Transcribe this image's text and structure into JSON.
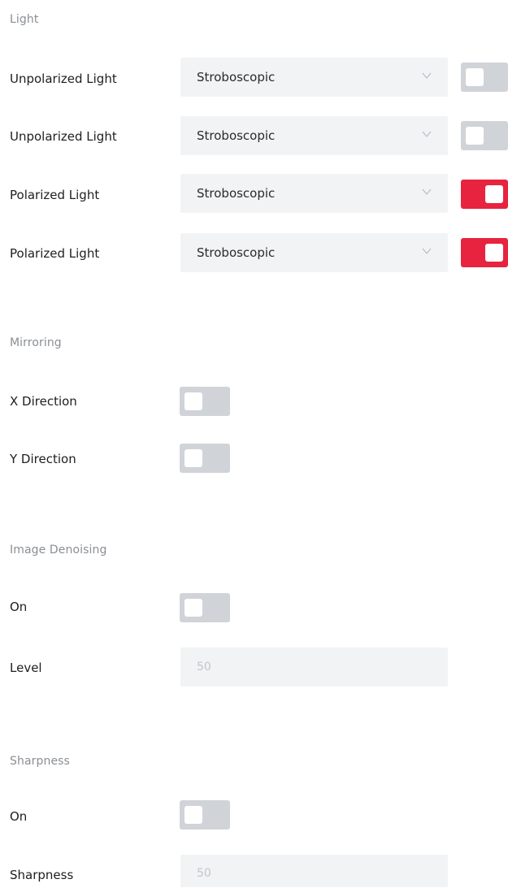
{
  "light": {
    "title": "Light",
    "rows": [
      {
        "label": "Unpolarized Light",
        "mode": "Stroboscopic",
        "enabled": false
      },
      {
        "label": "Unpolarized Light",
        "mode": "Stroboscopic",
        "enabled": false
      },
      {
        "label": "Polarized Light",
        "mode": "Stroboscopic",
        "enabled": true
      },
      {
        "label": "Polarized Light",
        "mode": "Stroboscopic",
        "enabled": true
      }
    ]
  },
  "mirroring": {
    "title": "Mirroring",
    "x_label": "X Direction",
    "x_enabled": false,
    "y_label": "Y Direction",
    "y_enabled": false
  },
  "denoising": {
    "title": "Image Denoising",
    "on_label": "On",
    "on_enabled": false,
    "level_label": "Level",
    "level_value": "50"
  },
  "sharpness": {
    "title": "Sharpness",
    "on_label": "On",
    "on_enabled": false,
    "value_label": "Sharpness",
    "value": "50"
  },
  "colors": {
    "accent": "#e8233f",
    "toggle_off": "#d0d3d8",
    "field_bg": "#f2f3f5",
    "section_title": "#8a8e94"
  },
  "icons": {
    "dropdown": "chevron-down-icon"
  }
}
